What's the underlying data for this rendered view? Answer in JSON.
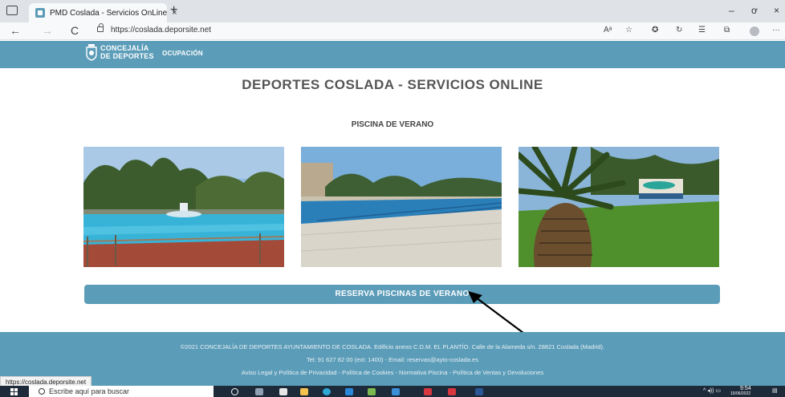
{
  "browser": {
    "tab_title": "PMD Coslada - Servicios OnLine",
    "url": "https://coslada.deporsite.net",
    "new_tab_symbol": "+",
    "tab_close_symbol": "×",
    "back_symbol": "←",
    "forward_symbol": "→",
    "refresh_symbol": "C",
    "minimize_symbol": "–",
    "restore_symbol": "ơ",
    "close_symbol": "×",
    "read_aloud": "Aᵃ",
    "more_symbol": "···",
    "status_url": "https://coslada.deporsite.net"
  },
  "site": {
    "logo_line1": "CONCEJALÍA",
    "logo_line2": "DE DEPORTES",
    "nav_item": "OCUPACIÓN",
    "colors": {
      "brand": "#5b9cb8",
      "title": "#555555"
    }
  },
  "main": {
    "page_title": "DEPORTES COSLADA - SERVICIOS ONLINE",
    "section_title": "PISCINA DE VERANO",
    "reserve_button": "RESERVA PISCINAS DE VERANO"
  },
  "footer": {
    "line1": "©2021 CONCEJALÍA DE DEPORTES AYUNTAMIENTO DE COSLADA. Edificio anexo C.D.M. EL PLANTÍO. Calle de la Alameda s/n. 28821 Coslada (Madrid).",
    "line2": "Tel: 91 627 82 00 (ext: 1400) - Email: reservas@ayto-coslada.es",
    "line3": "Aviso Legal y Política de Privacidad - Política de Cookies - Normativa Piscina - Política de Ventas y Devoluciones"
  },
  "taskbar": {
    "search_placeholder": "Escribe aquí para buscar",
    "time": "9:54",
    "date": "15/06/2022"
  }
}
